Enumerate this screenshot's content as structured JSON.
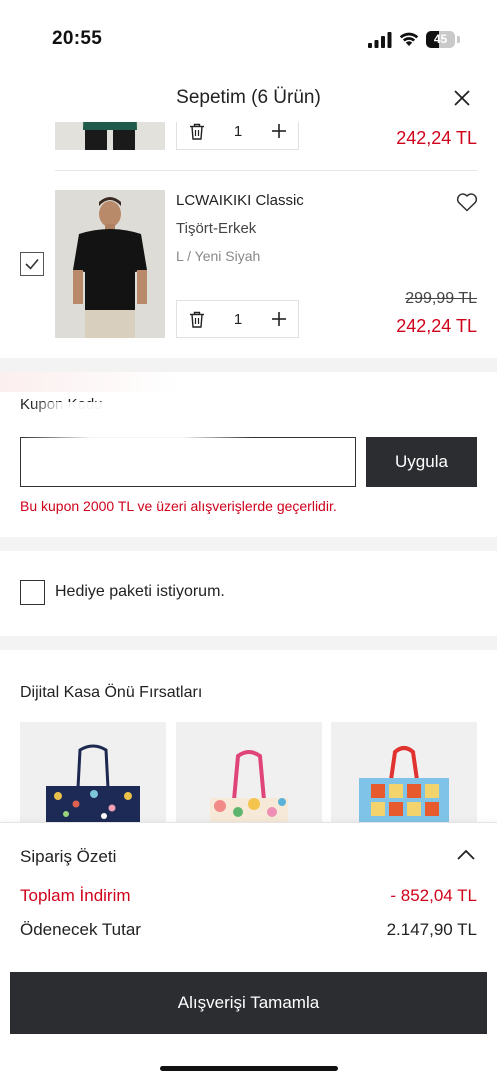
{
  "status_bar": {
    "time": "20:55",
    "battery_level": "45"
  },
  "header": {
    "title": "Sepetim (6 Ürün)"
  },
  "cart": {
    "items": [
      {
        "quantity": "1",
        "sale_price": "242,24 TL"
      },
      {
        "name": "LCWAIKIKI Classic",
        "type": "Tişört-Erkek",
        "variant": "L / Yeni Siyah",
        "quantity": "1",
        "old_price": "299,99 TL",
        "sale_price": "242,24 TL",
        "checked": true
      }
    ]
  },
  "coupon": {
    "label": "Kupon Kodu",
    "input_value": "",
    "button_label": "Uygula",
    "error": "Bu kupon 2000 TL ve üzeri alışverişlerde geçerlidir."
  },
  "gift": {
    "label": "Hediye paketi istiyorum.",
    "checked": false
  },
  "offers": {
    "title": "Dijital Kasa Önü Fırsatları"
  },
  "summary": {
    "title": "Sipariş Özeti",
    "discount_label": "Toplam İndirim",
    "discount_value": "- 852,04 TL",
    "total_label": "Ödenecek Tutar",
    "total_value": "2.147,90 TL",
    "checkout_label": "Alışverişi Tamamla"
  },
  "colors": {
    "accent_red": "#d0021b",
    "button_dark": "#2b2d31"
  }
}
